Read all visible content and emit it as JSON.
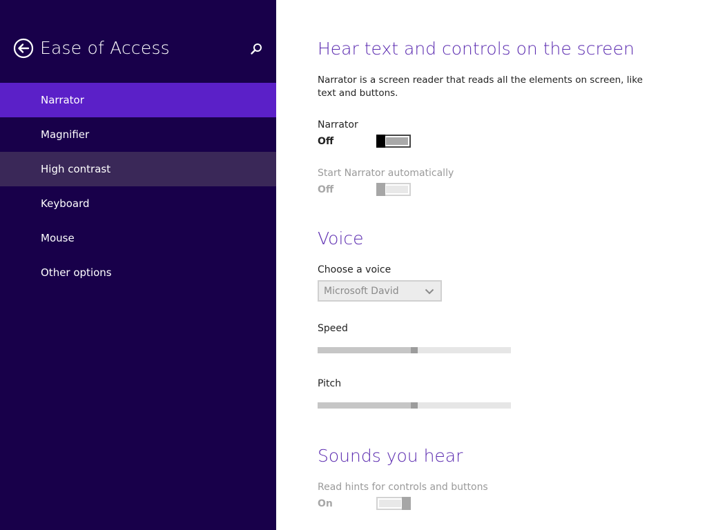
{
  "sidebar": {
    "title": "Ease of Access",
    "back_icon": "back-arrow-icon",
    "search_icon": "search-icon",
    "items": [
      {
        "label": "Narrator",
        "state": "selected"
      },
      {
        "label": "Magnifier",
        "state": "normal"
      },
      {
        "label": "High contrast",
        "state": "hover"
      },
      {
        "label": "Keyboard",
        "state": "normal"
      },
      {
        "label": "Mouse",
        "state": "normal"
      },
      {
        "label": "Other options",
        "state": "normal"
      }
    ]
  },
  "main": {
    "hear_section": {
      "heading": "Hear text and controls on the screen",
      "description": "Narrator is a screen reader that reads all the elements on screen, like text and buttons.",
      "narrator": {
        "label": "Narrator",
        "state": "Off",
        "on": false,
        "enabled": true
      },
      "start_auto": {
        "label": "Start Narrator automatically",
        "state": "Off",
        "on": false,
        "enabled": false
      }
    },
    "voice_section": {
      "heading": "Voice",
      "choose_label": "Choose a voice",
      "selected_voice": "Microsoft David",
      "speed": {
        "label": "Speed",
        "value": 0.5
      },
      "pitch": {
        "label": "Pitch",
        "value": 0.5
      }
    },
    "sounds_section": {
      "heading": "Sounds you hear",
      "read_hints": {
        "label": "Read hints for controls and buttons",
        "state": "On",
        "on": true,
        "enabled": false
      }
    }
  },
  "colors": {
    "sidebar_bg": "#18004a",
    "selected_item": "#5b20c8",
    "hover_item": "#3a2858",
    "heading": "#5b2bb0"
  }
}
